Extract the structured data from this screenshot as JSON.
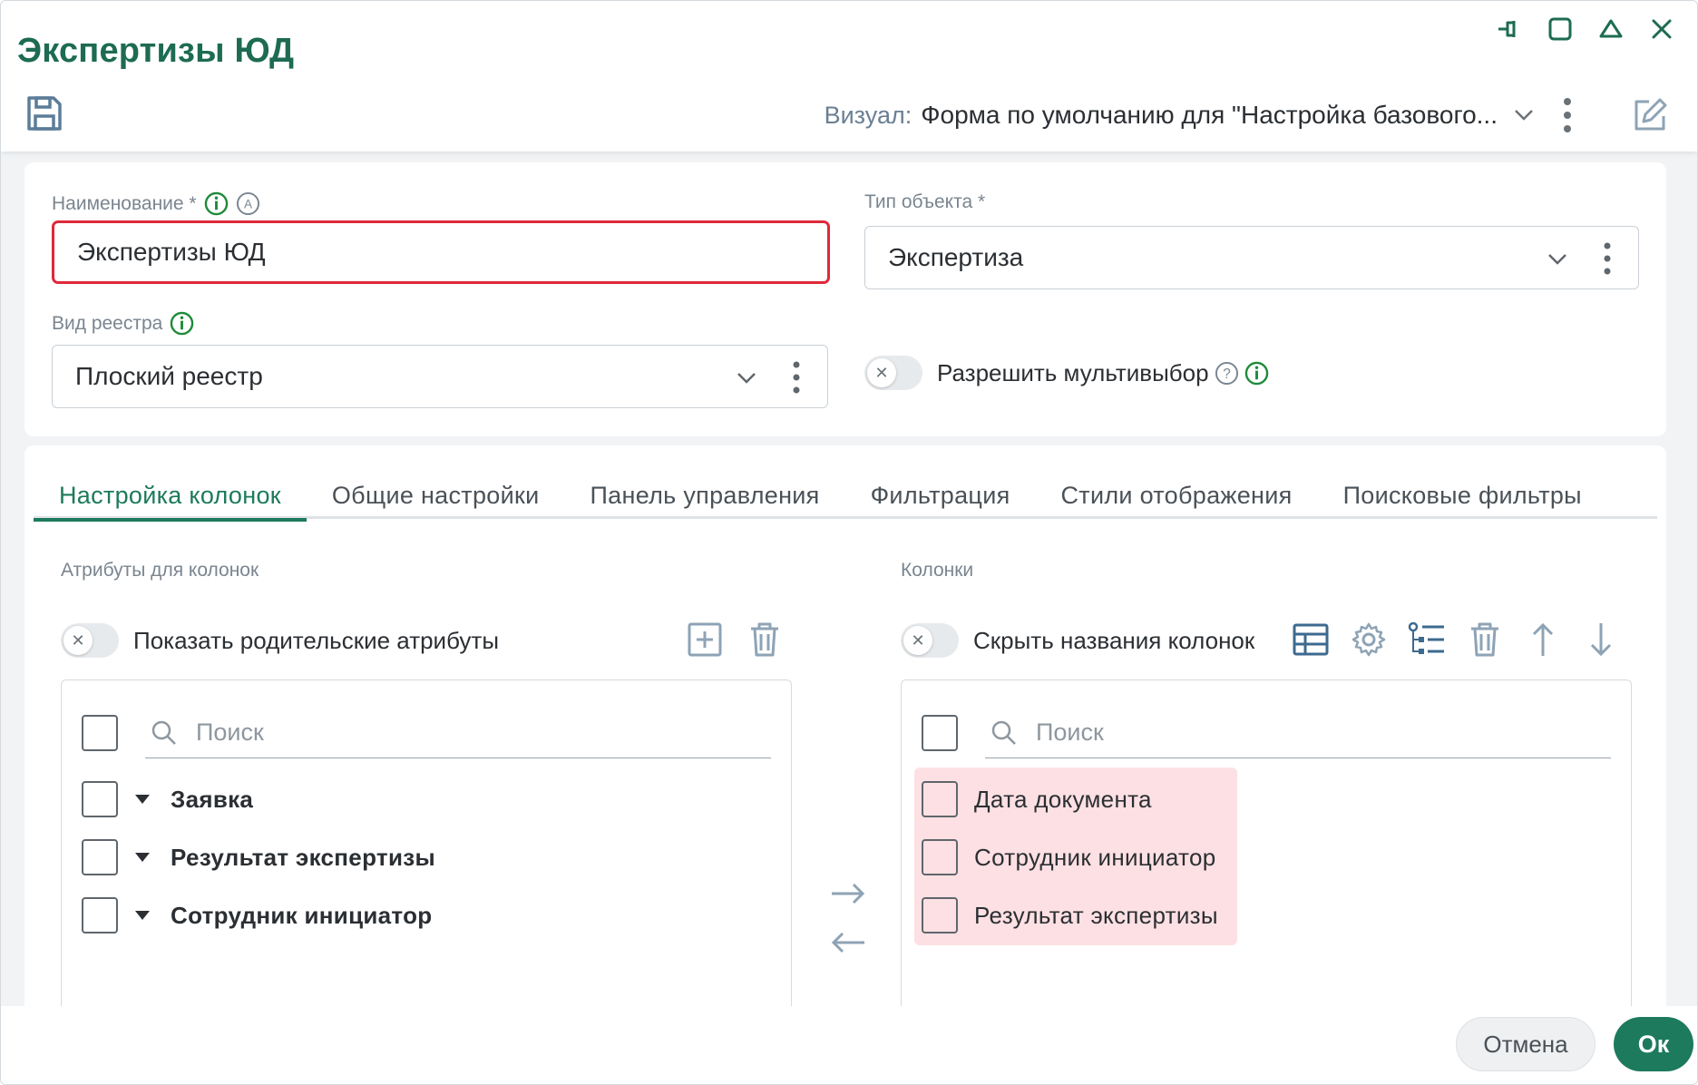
{
  "window": {
    "title": "Экспертизы ЮД",
    "controls": [
      "pin-icon",
      "maximize-icon",
      "collapse-icon",
      "close-icon"
    ]
  },
  "toolbar": {
    "save_icon": "save-icon",
    "visual_label": "Визуал:",
    "visual_value": "Форма по умолчанию для \"Настройка базового..."
  },
  "form": {
    "name_label": "Наименование *",
    "name_value": "Экспертизы ЮД",
    "object_type_label": "Тип объекта *",
    "object_type_value": "Экспертиза",
    "registry_label": "Вид реестра",
    "registry_value": "Плоский реестр",
    "multiselect_label": "Разрешить мультивыбор"
  },
  "tabs": [
    {
      "label": "Настройка колонок",
      "active": true
    },
    {
      "label": "Общие настройки",
      "active": false
    },
    {
      "label": "Панель управления",
      "active": false
    },
    {
      "label": "Фильтрация",
      "active": false
    },
    {
      "label": "Стили отображения",
      "active": false
    },
    {
      "label": "Поисковые фильтры",
      "active": false
    }
  ],
  "attributes_panel": {
    "title": "Атрибуты для колонок",
    "toggle_label": "Показать родительские атрибуты",
    "search_placeholder": "Поиск",
    "items": [
      "Заявка",
      "Результат экспертизы",
      "Сотрудник инициатор"
    ]
  },
  "columns_panel": {
    "title": "Колонки",
    "toggle_label": "Скрыть названия колонок",
    "search_placeholder": "Поиск",
    "items": [
      "Дата документа",
      "Сотрудник инициатор",
      "Результат экспертизы"
    ],
    "highlight_color": "#fde0e3"
  },
  "footer": {
    "cancel_label": "Отмена",
    "ok_label": "Ок"
  },
  "colors": {
    "accent": "#1d7a5c",
    "title": "#1d6b52",
    "error_border": "#e0293a",
    "icon_blue": "#5c7d99"
  }
}
